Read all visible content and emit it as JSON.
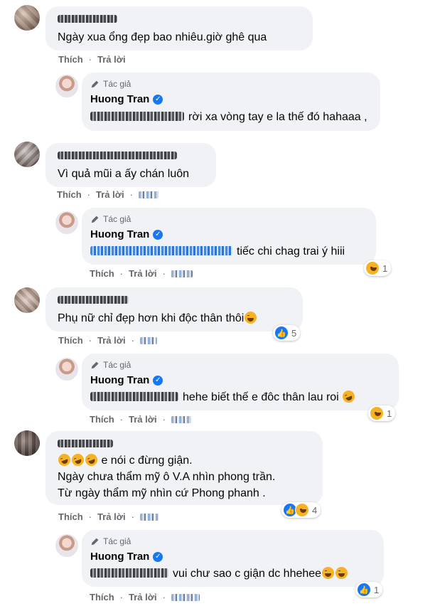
{
  "ui": {
    "like_label": "Thích",
    "reply_label": "Trả lời",
    "author_tag": "Tác giả",
    "icons": [
      "pencil-icon",
      "verified-badge-icon",
      "like-reaction-icon",
      "haha-reaction-icon"
    ],
    "colors": {
      "bubble": "#f0f2f5",
      "meta": "#65676b",
      "like_blue": "#1877f2",
      "haha_yellow": "#f7b125"
    }
  },
  "comments": [
    {
      "text": "Ngày xua ổng đẹp bao nhiêu.giờ ghê qua"
    },
    {
      "text": "Vì quả mũi a ấy chán luôn"
    },
    {
      "text": "Phụ nữ chỉ đẹp hơn khi độc thân thôi",
      "reactions": "5"
    },
    {
      "lines": [
        "e nói c đừng giận.",
        "Ngày chưa thẩm mỹ ô V.A nhìn phong trần.",
        "Từ ngày thẩm mỹ nhìn cứ Phong phanh ."
      ],
      "reactions": "4"
    }
  ],
  "replies": [
    {
      "author": "Huong Tran",
      "text": "rời xa vòng tay e la thế đó hahaaa ,"
    },
    {
      "author": "Huong Tran",
      "text": "tiếc chi chag trai ý hiii",
      "reactions": "1"
    },
    {
      "author": "Huong Tran",
      "text": "hehe biết thế e đôc thân lau roi",
      "reactions": "1"
    },
    {
      "author": "Huong Tran",
      "text": "vui chư sao c giận dc hhehee",
      "reactions": "1"
    }
  ]
}
